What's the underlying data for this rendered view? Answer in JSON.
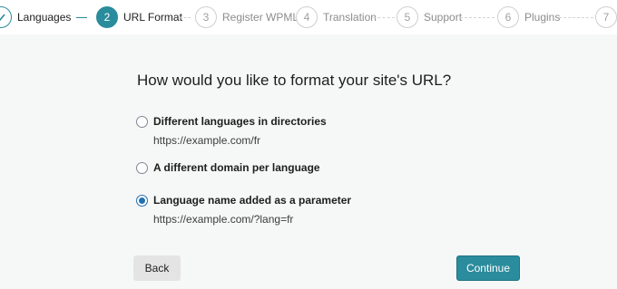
{
  "steps": [
    {
      "num": "✓",
      "label": "Languages",
      "state": "done"
    },
    {
      "num": "2",
      "label": "URL Format",
      "state": "active"
    },
    {
      "num": "3",
      "label": "Register WPML",
      "state": "todo"
    },
    {
      "num": "4",
      "label": "Translation",
      "state": "todo"
    },
    {
      "num": "5",
      "label": "Support",
      "state": "todo"
    },
    {
      "num": "6",
      "label": "Plugins",
      "state": "todo"
    },
    {
      "num": "7",
      "label": "",
      "state": "todo"
    }
  ],
  "main": {
    "title": "How would you like to format your site's URL?",
    "options": [
      {
        "label": "Different languages in directories",
        "example": "https://example.com/fr",
        "selected": false
      },
      {
        "label": "A different domain per language",
        "example": "",
        "selected": false
      },
      {
        "label": "Language name added as a parameter",
        "example": "https://example.com/?lang=fr",
        "selected": true
      }
    ]
  },
  "buttons": {
    "back": "Back",
    "continue": "Continue"
  },
  "colors": {
    "accent": "#2a8c9c",
    "radio_selected": "#2271b1"
  }
}
